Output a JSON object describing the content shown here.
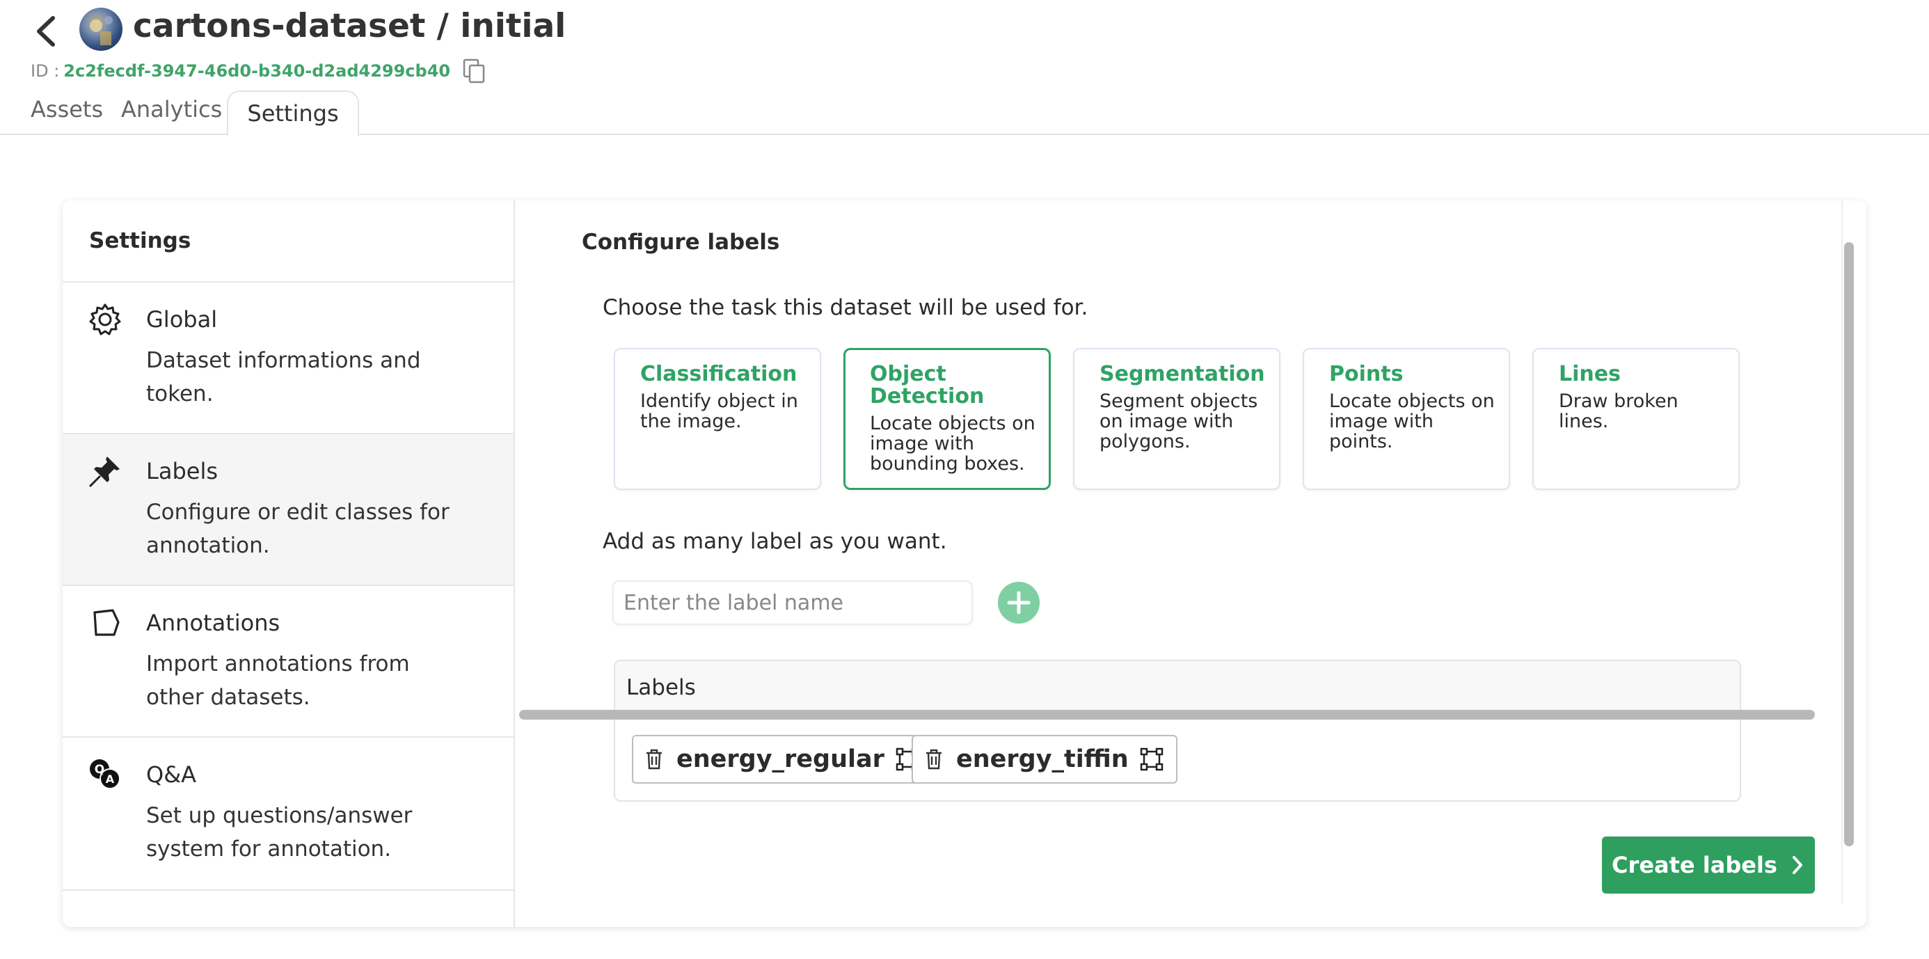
{
  "header": {
    "title": "cartons-dataset / initial",
    "id_label": "ID :",
    "id_value": "2c2fecdf-3947-46d0-b340-d2ad4299cb40"
  },
  "tabs": [
    {
      "label": "Assets"
    },
    {
      "label": "Analytics"
    },
    {
      "label": "Settings",
      "active": true
    }
  ],
  "sidebar": {
    "title": "Settings",
    "items": [
      {
        "label": "Global",
        "description": "Dataset informations and token.",
        "icon": "gear-icon"
      },
      {
        "label": "Labels",
        "description": "Configure or edit classes for annotation.",
        "icon": "pin-icon",
        "active": true
      },
      {
        "label": "Annotations",
        "description": "Import annotations from other datasets.",
        "icon": "polygon-icon"
      },
      {
        "label": "Q&A",
        "description": "Set up questions/answer system for annotation.",
        "icon": "qa-icon"
      }
    ]
  },
  "main": {
    "title": "Configure labels",
    "choose_text": "Choose the task this dataset will be used for.",
    "tasks": [
      {
        "name": "Classification",
        "description": "Identify object in the image."
      },
      {
        "name": "Object Detection",
        "description": "Locate objects on image with bounding boxes.",
        "selected": true
      },
      {
        "name": "Segmentation",
        "description": "Segment objects on image with polygons."
      },
      {
        "name": "Points",
        "description": "Locate objects on image with points."
      },
      {
        "name": "Lines",
        "description": "Draw broken lines."
      }
    ],
    "add_text": "Add as many label as you want.",
    "input_placeholder": "Enter the label name",
    "input_value": "",
    "labels_header": "Labels",
    "labels": [
      "energy_regular",
      "energy_tiffin"
    ],
    "create_button": "Create labels"
  },
  "colors": {
    "accent_green": "#2e9f5e",
    "id_green": "#3fa46a",
    "add_button_green": "#7fcfa3",
    "selected_task_border": "#2fa364"
  }
}
